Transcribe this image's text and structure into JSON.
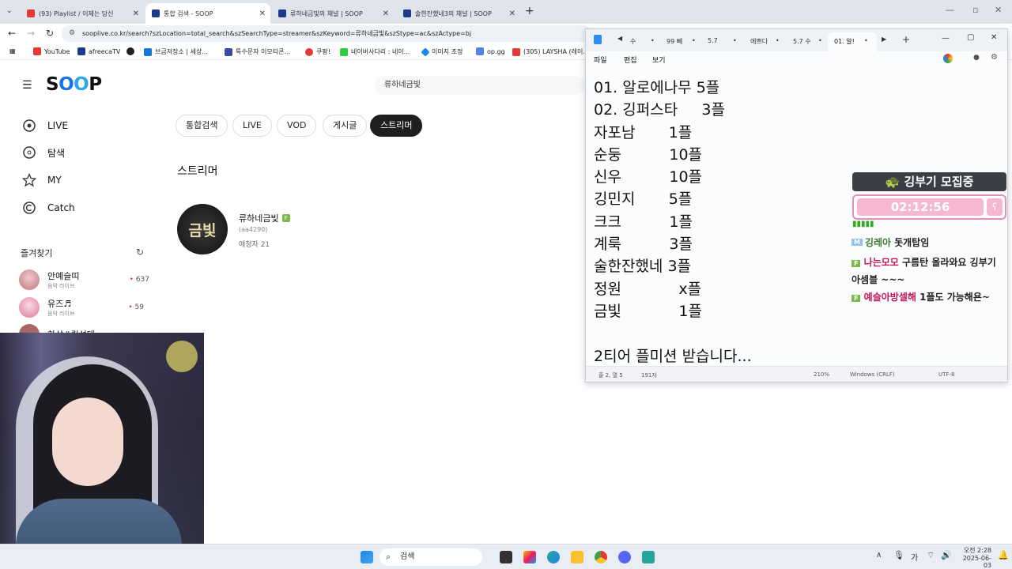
{
  "browser": {
    "tabs": [
      {
        "title": "(93) Playlist / 이제는 당신",
        "color": "#e53935"
      },
      {
        "title": "통합 검색 - SOOP",
        "color": "#1e3a8a"
      },
      {
        "title": "류하네금빛의 채널 | SOOP",
        "color": "#1e3a8a"
      },
      {
        "title": "술한잔했네3의 채널 | SOOP",
        "color": "#1e3a8a"
      }
    ],
    "url": "sooplive.co.kr/search?szLocation=total_search&szSearchType=streamer&szKeyword=류하네금빛&szStype=ac&szActype=bj",
    "bookmarks": [
      "YouTube",
      "afreecaTV",
      "",
      "브금저장소 | 세상...",
      "특수문자 이모티콘...",
      "쿠팡!",
      "네이버사다리 : 네이...",
      "이미지 조정",
      "op.gg",
      "(305) LAYSHA (레이..."
    ]
  },
  "soop": {
    "logo": "SOOP",
    "search_value": "류하네금빛",
    "nav": [
      "LIVE",
      "탐색",
      "MY",
      "Catch"
    ],
    "favorites_title": "즐겨찾기",
    "favorites": [
      {
        "name": "안예슬띠",
        "sub": "음악 라이브",
        "count": "637"
      },
      {
        "name": "유즈♬",
        "sub": "음악 라이브",
        "count": "59"
      },
      {
        "name": "하삼#킹성태",
        "sub": "",
        "count": ""
      }
    ],
    "filters": [
      "통합검색",
      "LIVE",
      "VOD",
      "게시글",
      "스트리머"
    ],
    "section_title": "스트리머",
    "result": {
      "name": "류하네금빛",
      "badge": "F",
      "id": "(aa4290)",
      "fans": "애청자 21",
      "thumb": "금빛"
    }
  },
  "notepad": {
    "tabs": [
      "수",
      "99 뻬",
      "5.7",
      "에쁘다",
      "5.7 수",
      "01. 알!"
    ],
    "menu": [
      "파일",
      "편집",
      "보기"
    ],
    "lines": [
      "01. 알로에나무 5플",
      "02. 깅퍼스타     3플",
      "자포남       1플",
      "순둥          10플",
      "신우          10플",
      "깅민지       5플",
      "크크          1플",
      "계룩          3플",
      "술한잔했네 3플",
      "정원            x플",
      "금빛            1플",
      "",
      "2티어 플미션 받습니다..."
    ],
    "status": {
      "pos": "줄 2, 열 5",
      "chars": "191자",
      "zoom": "210%",
      "eol": "Windows (CRLF)",
      "enc": "UTF-8"
    }
  },
  "overlay": {
    "title": "깅부기 모집중",
    "timer": "02:12:56",
    "chat": [
      {
        "badge": "M",
        "name": "깅레아",
        "msg": "돗개탑임"
      },
      {
        "badge": "F",
        "name": "나는모모",
        "msg": "구름탄 올라와요 깅부기 아셈블 ~~~"
      },
      {
        "badge": "F",
        "name": "예슬아방셀해",
        "msg": "1플도 가능해욘~"
      }
    ]
  },
  "taskbar": {
    "search": "검색",
    "ime": "가",
    "time": "오전 2:28",
    "date": "2025-06-03"
  },
  "colors": {
    "soop_blue": "#1a73e8",
    "chip_active": "#1f1f1f",
    "overlay_title_bg": "#3a3f46",
    "timer_pink": "#f6b8d1"
  }
}
